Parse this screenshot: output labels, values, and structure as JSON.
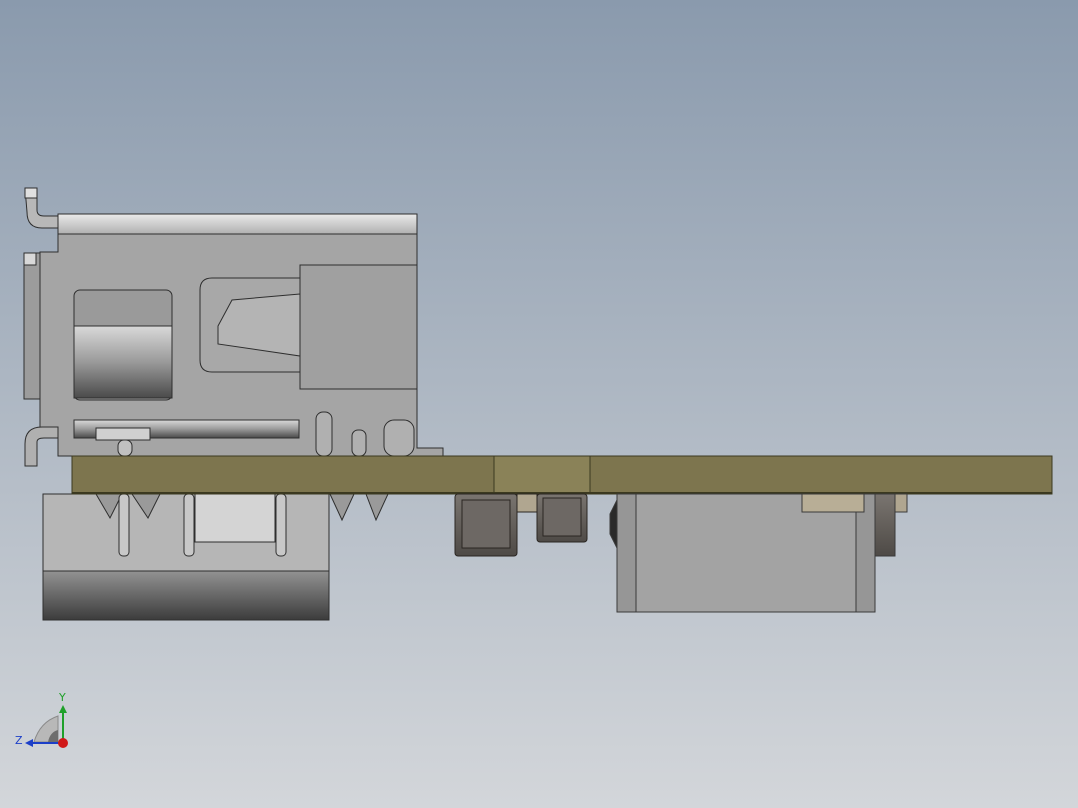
{
  "viewport": {
    "background_top": "#8a9aad",
    "background_bottom": "#d3d6da"
  },
  "model": {
    "pcb_color": "#7d754e",
    "pcb_edge": "#3b3920",
    "metal_color": "#a4a4a4",
    "metal_dark": "#5a5a5a",
    "component_dark": "#6a6560",
    "component_tan": "#b0a690"
  },
  "triad": {
    "y_label": "Y",
    "z_label": "Z",
    "y_color": "#1fa02a",
    "z_color": "#1c3fc8",
    "origin_color": "#d01818"
  }
}
